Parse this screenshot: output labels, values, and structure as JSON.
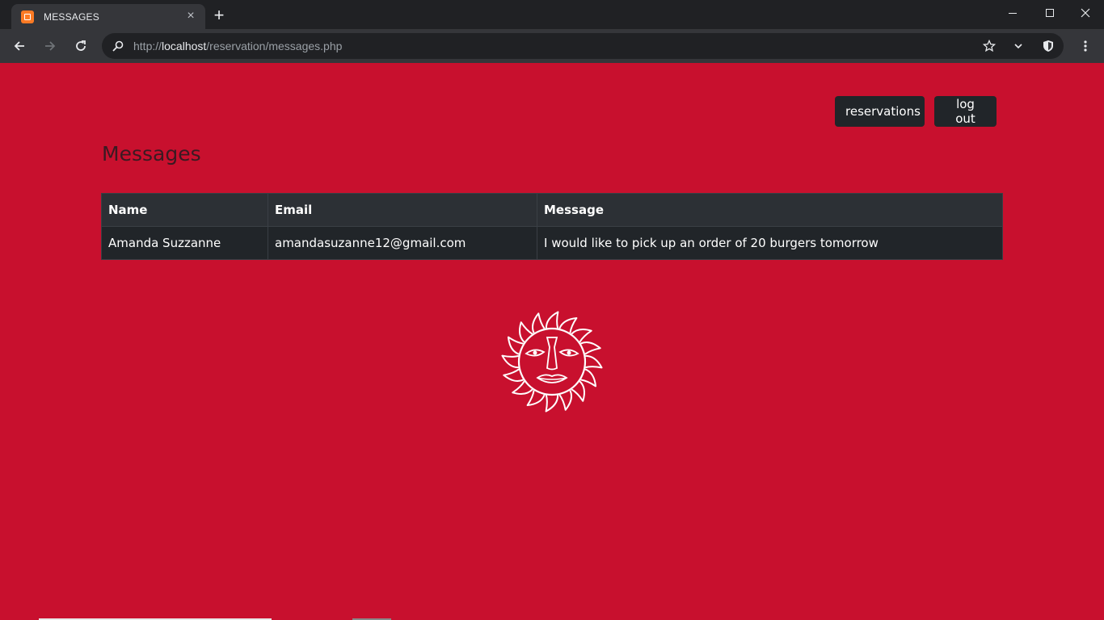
{
  "browser": {
    "tab_title": "MESSAGES",
    "url_scheme": "http://",
    "url_host": "localhost",
    "url_path": "/reservation/messages.php"
  },
  "nav": {
    "reservations_label": "reservations",
    "logout_label": "log out"
  },
  "page": {
    "title": "Messages"
  },
  "table": {
    "headers": [
      "Name",
      "Email",
      "Message"
    ],
    "rows": [
      {
        "name": "Amanda Suzzanne",
        "email": "amandasuzanne12@gmail.com",
        "message": "I would like to pick up an order of 20 burgers tomorrow"
      }
    ]
  },
  "colors": {
    "page_background": "#c8102e",
    "button_background": "#212529",
    "table_header": "#2c3035",
    "table_body": "#212529",
    "title_text": "#3a1a22"
  },
  "icons": [
    "xampp-favicon-icon",
    "close-icon",
    "plus-icon",
    "back-arrow-icon",
    "forward-arrow-icon",
    "reload-icon",
    "search-icon",
    "star-icon",
    "chevron-down-icon",
    "shield-icon",
    "kebab-menu-icon",
    "sun-face-logo"
  ]
}
